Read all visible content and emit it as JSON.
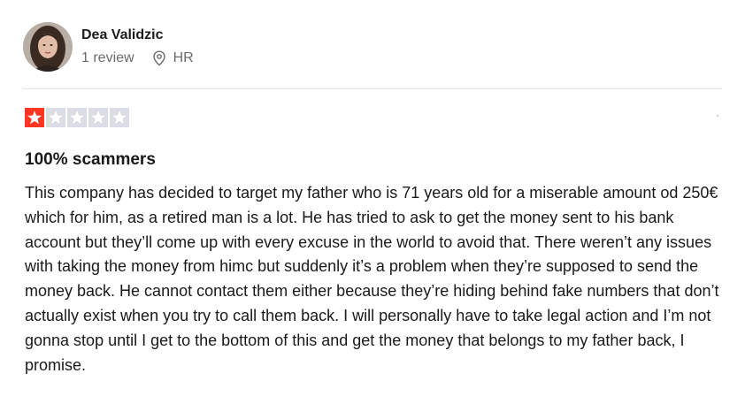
{
  "reviewer": {
    "name": "Dea Validzic",
    "review_count": "1 review",
    "country": "HR",
    "avatar_icon": "avatar-photo"
  },
  "rating": {
    "value": 1,
    "max": 5,
    "filled_color": "#ff3722",
    "empty_color": "#dcdce6"
  },
  "review": {
    "title": "100% scammers",
    "body": "This company has decided to target my father who is 71 years old for a miserable amount od 250€ which for him, as a retired man is a lot. He has tried to ask to get the money sent to his bank account but they’ll come up with every excuse in the world to avoid that. There weren’t any issues with taking the money from himc but suddenly it’s a problem when they’re supposed to send the money back. He cannot contact them either because they’re hiding behind fake numbers that don’t actually exist when you try to call them back. I will personally have to take legal action and I’m not gonna stop until I get to the bottom of this and get the money that belongs to my father back, I promise."
  },
  "icons": {
    "location": "location-pin-icon",
    "star": "star-icon"
  }
}
